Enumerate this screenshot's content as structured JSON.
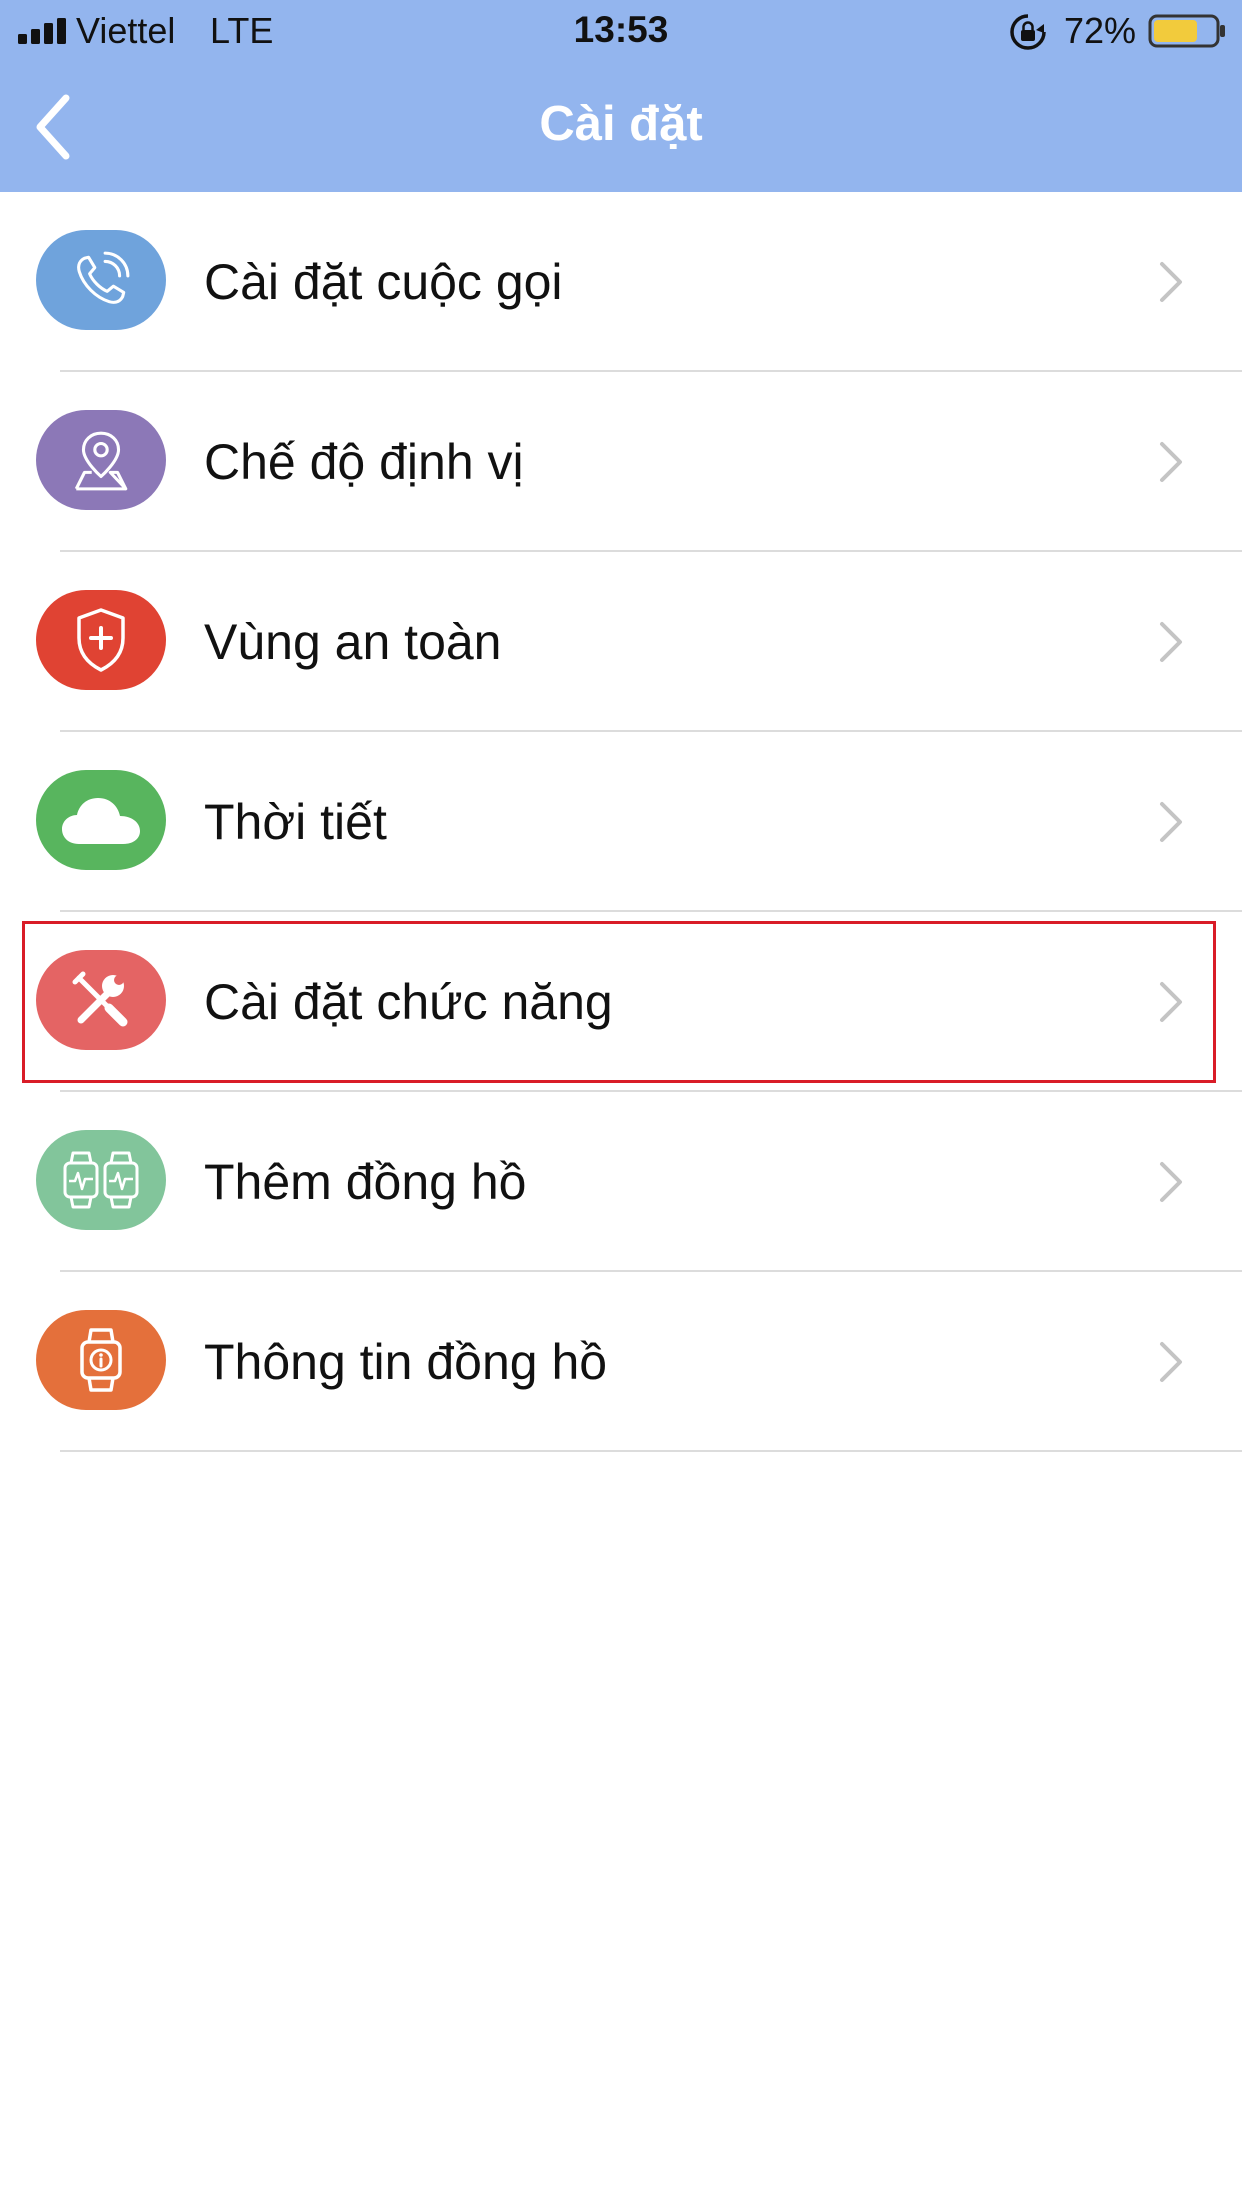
{
  "status_bar": {
    "carrier": "Viettel",
    "network": "LTE",
    "time": "13:53",
    "battery_percent": "72%",
    "battery_level": 0.72,
    "icons": [
      "signal-icon",
      "orientation-lock-icon",
      "battery-icon"
    ]
  },
  "nav": {
    "back_icon": "chevron-left-icon",
    "title": "Cài đặt"
  },
  "settings": {
    "items": [
      {
        "label": "Cài đặt cuộc gọi",
        "icon": "phone-icon",
        "color": "#6fa3dc"
      },
      {
        "label": "Chế độ định vị",
        "icon": "location-pin-icon",
        "color": "#8c78b7"
      },
      {
        "label": "Vùng an toàn",
        "icon": "shield-icon",
        "color": "#e04333"
      },
      {
        "label": "Thời tiết",
        "icon": "cloud-icon",
        "color": "#58b55e"
      },
      {
        "label": "Cài đặt chức năng",
        "icon": "tools-icon",
        "color": "#e46464",
        "highlighted": true
      },
      {
        "label": "Thêm đồng hồ",
        "icon": "watches-icon",
        "color": "#82c59b"
      },
      {
        "label": "Thông tin đồng hồ",
        "icon": "watch-info-icon",
        "color": "#e4703b"
      }
    ]
  },
  "colors": {
    "header": "#93b5ee",
    "highlight_border": "#d91c27",
    "chevron": "#c4c4c4",
    "separator": "#dcdcdc"
  }
}
